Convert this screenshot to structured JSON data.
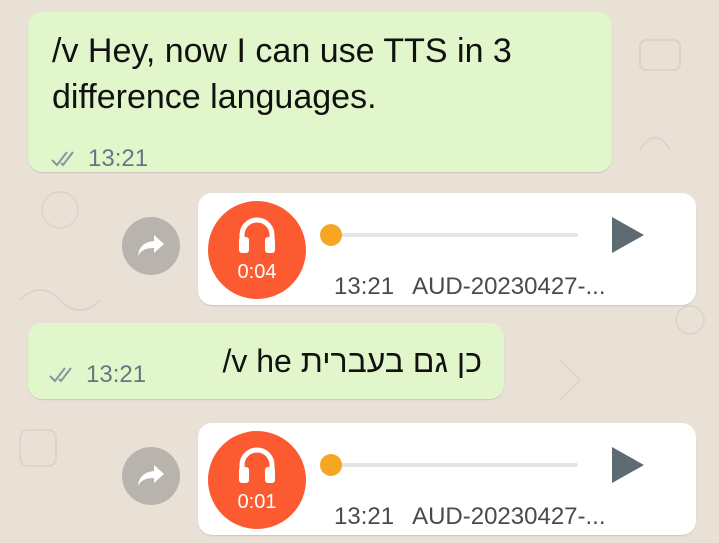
{
  "messages": [
    {
      "text_line1": "/v Hey, now I can use TTS in 3",
      "text_line2": "difference languages.",
      "time": "13:21",
      "status": "delivered-double-check"
    },
    {
      "duration": "0:04",
      "time": "13:21",
      "filename": "AUD-20230427-...",
      "progress": 0
    },
    {
      "text": "/v he כן גם בעברית",
      "time": "13:21",
      "status": "delivered-double-check"
    },
    {
      "duration": "0:01",
      "time": "13:21",
      "filename": "AUD-20230427-...",
      "progress": 0
    }
  ],
  "colors": {
    "outgoing_bubble": "#e1f7cb",
    "incoming_bubble": "#ffffff",
    "avatar": "#fc5b32",
    "progress_knob": "#f6a623",
    "wallpaper": "#e9e1d6"
  },
  "icons": [
    "double-check-icon",
    "forward-icon",
    "headphones-icon",
    "play-icon"
  ]
}
